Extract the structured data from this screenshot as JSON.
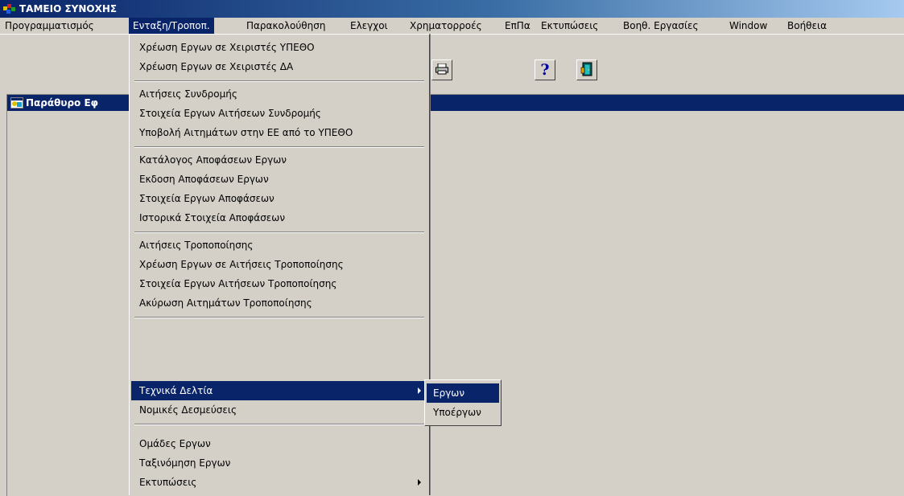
{
  "window": {
    "title": "ΤΑΜΕΙΟ ΣΥΝΟΧΗΣ"
  },
  "menubar": {
    "items": [
      "Προγραμματισμός",
      "Ενταξη/Τροποπ.",
      "Παρακολούθηση",
      "Ελεγχοι",
      "Χρηματορροές",
      "ΕπΠα",
      "Εκτυπώσεις",
      "Βοηθ. Εργασίες",
      "Window",
      "Βοήθεια"
    ],
    "active_index": 1
  },
  "toolbar": {
    "icons": [
      "printer-icon",
      "help-icon",
      "exit-door-icon"
    ],
    "help_glyph": "?"
  },
  "mdi_window": {
    "title": "Παράθυρο Εφ"
  },
  "dropdown": {
    "items": [
      {
        "label": "Χρέωση Εργων σε Χειριστές ΥΠΕΘΟ"
      },
      {
        "label": "Χρέωση Εργων σε Χειριστές ΔΑ"
      },
      {
        "label": "Αιτήσεις Συνδρομής"
      },
      {
        "label": "Στοιχεία Εργων Αιτήσεων Συνδρομής"
      },
      {
        "label": "Υποβολή Αιτημάτων στην ΕΕ από το ΥΠΕΘΟ"
      },
      {
        "label": "Κατάλογος Αποφάσεων Εργων"
      },
      {
        "label": "Εκδοση Αποφάσεων Εργων"
      },
      {
        "label": "Στοιχεία Εργων Αποφάσεων"
      },
      {
        "label": "Ιστορικά Στοιχεία Αποφάσεων"
      },
      {
        "label": "Αιτήσεις Τροποποίησης"
      },
      {
        "label": "Χρέωση Εργων σε Αιτήσεις Τροποποίησης"
      },
      {
        "label": "Στοιχεία Εργων Αιτήσεων Τροποποίησης"
      },
      {
        "label": "Ακύρωση Αιτημάτων Τροποποίησης"
      },
      {
        "label": "Τεχνικά Δελτία",
        "submenu": true,
        "highlighted": true
      },
      {
        "label": "Νομικές Δεσμεύσεις"
      },
      {
        "label": "Ομάδες Εργων"
      },
      {
        "label": "Ταξινόμηση Εργων"
      },
      {
        "label": "Εκτυπώσεις",
        "submenu": true
      }
    ]
  },
  "submenu": {
    "items": [
      "Εργων",
      "Υποέργων"
    ],
    "highlighted_index": 0
  },
  "colors": {
    "selection": "#0a246a",
    "face": "#d4d0c8",
    "title_gradient_end": "#a6caf0"
  }
}
